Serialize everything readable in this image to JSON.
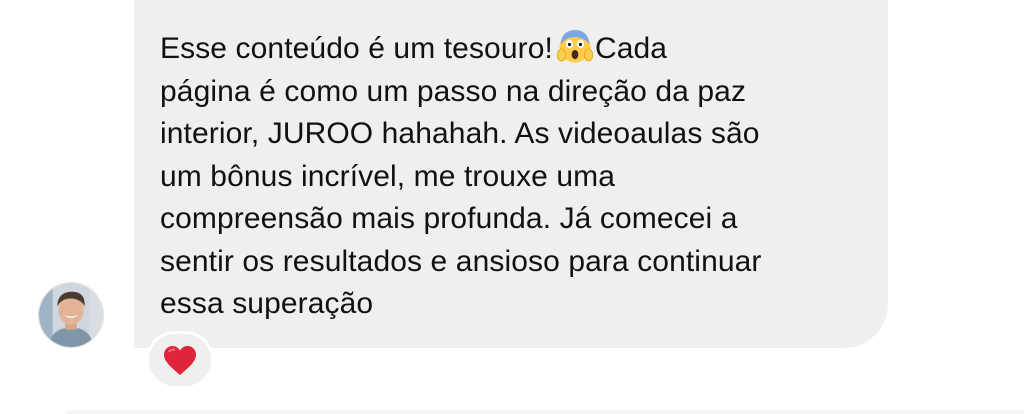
{
  "message": {
    "lines": [
      "Esse conteúdo é um tesouro!",
      "Cada",
      "página é como um passo na direção da paz",
      "interior, JUROO hahahah. As videoaulas são",
      "um bônus incrível, me trouxe uma",
      "compreensão mais profunda. Já comecei a",
      "sentir os resultados e ansioso para continuar",
      "essa superação"
    ],
    "inline_emoji": "face-screaming-in-fear-icon"
  },
  "reaction": {
    "emoji": "red-heart-icon"
  },
  "colors": {
    "bubble_background": "#efefef",
    "text": "#111111",
    "heart": "#e0243a",
    "page_background": "#ffffff"
  }
}
